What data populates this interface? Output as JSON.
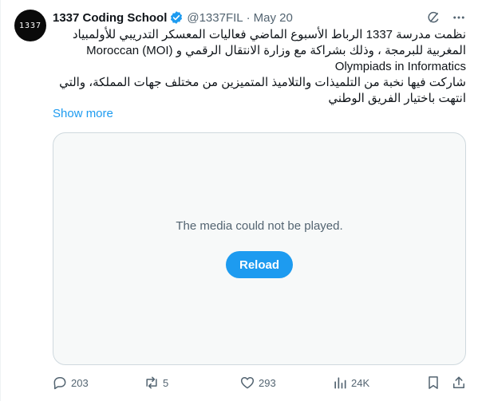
{
  "author": {
    "avatar_text": "1337",
    "name": "1337 Coding School",
    "handle": "@1337FIL",
    "separator": "·",
    "date": "May 20"
  },
  "tweet": {
    "lines": [
      "نظمت مدرسة 1337 الرباط الأسبوع الماضي فعاليات المعسكر التدريبي للأولمبياد",
      "المغربية للبرمجة ، وذلك بشراكة مع وزارة الانتقال الرقمي و (MOI)  Moroccan",
      "Olympiads in Informatics",
      "شاركت فيها نخبة من التلميذات والتلاميذ المتميزين من مختلف جهات المملكة، والتي",
      "انتهت باختيار الفريق الوطني"
    ],
    "show_more": "Show more"
  },
  "media": {
    "message": "The media could not be played.",
    "reload_label": "Reload"
  },
  "actions": {
    "replies": "203",
    "reposts": "5",
    "likes": "293",
    "views": "24K"
  },
  "colors": {
    "accent": "#1d9bf0",
    "muted": "#536471",
    "border": "#cfd9de"
  },
  "icons": [
    "grok-icon",
    "more-icon",
    "verified-badge-icon",
    "reply-icon",
    "repost-icon",
    "like-icon",
    "views-icon",
    "bookmark-icon",
    "share-icon"
  ]
}
